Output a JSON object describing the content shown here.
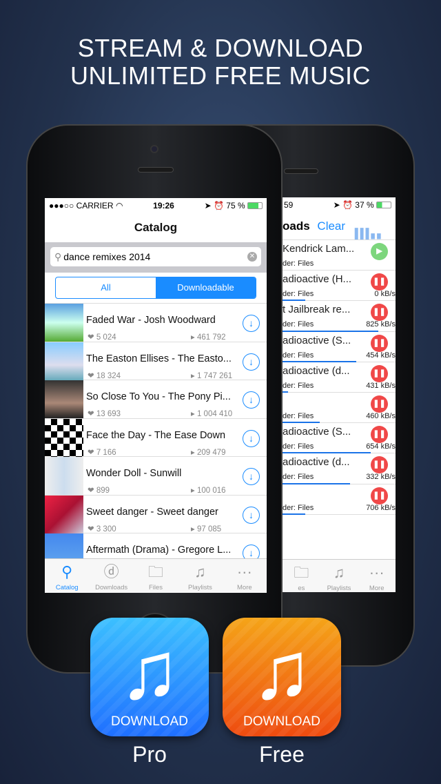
{
  "headline": {
    "line1": "STREAM & DOWNLOAD",
    "line2": "UNLIMITED FREE MUSIC"
  },
  "front": {
    "status": {
      "carrier": "●●●○○ CARRIER",
      "time": "19:26",
      "battery": "75 %"
    },
    "nav_title": "Catalog",
    "search": {
      "value": "dance remixes 2014",
      "icon": "search-icon"
    },
    "segments": [
      "All",
      "Downloadable"
    ],
    "selected_segment": "Downloadable",
    "tracks": [
      {
        "title": "Faded War - Josh Woodward",
        "likes": "5 024",
        "plays": "461 792"
      },
      {
        "title": "The Easton Ellises - The Easto...",
        "likes": "18 324",
        "plays": "1 747 261"
      },
      {
        "title": "So Close To You - The Pony Pi...",
        "likes": "13 693",
        "plays": "1 004 410"
      },
      {
        "title": "Face the Day - The Ease Down",
        "likes": "7 166",
        "plays": "209 479"
      },
      {
        "title": "Wonder Doll - Sunwill",
        "likes": "899",
        "plays": "100 016"
      },
      {
        "title": "Sweet danger - Sweet danger",
        "likes": "3 300",
        "plays": "97 085"
      },
      {
        "title": "Aftermath (Drama) - Gregore L...",
        "likes": "",
        "plays": ""
      }
    ],
    "tabs": [
      "Catalog",
      "Downloads",
      "Files",
      "Playlists",
      "More"
    ],
    "active_tab": "Catalog"
  },
  "back": {
    "status": {
      "time": "59",
      "battery": "37 %"
    },
    "nav_title": "oads",
    "clear": "Clear",
    "downloads": [
      {
        "title": "Kendrick Lam...",
        "folder": "der: Files",
        "speed": "",
        "state": "play",
        "progress": 0
      },
      {
        "title": "adioactive (H...",
        "folder": "der: Files",
        "speed": "0 kB/s",
        "state": "pause",
        "progress": 0.2
      },
      {
        "title": "t Jailbreak re...",
        "folder": "der: Files",
        "speed": "825 kB/s",
        "state": "pause",
        "progress": 0.85
      },
      {
        "title": "adioactive (S...",
        "folder": "der: Files",
        "speed": "454 kB/s",
        "state": "pause",
        "progress": 0.65
      },
      {
        "title": "adioactive (d...",
        "folder": "der: Files",
        "speed": "431 kB/s",
        "state": "pause",
        "progress": 0.05
      },
      {
        "title": "",
        "folder": "der: Files",
        "speed": "460 kB/s",
        "state": "pause",
        "progress": 0.33
      },
      {
        "title": "adioactive (S...",
        "folder": "der: Files",
        "speed": "654 kB/s",
        "state": "pause",
        "progress": 0.78
      },
      {
        "title": "adioactive (d...",
        "folder": "der: Files",
        "speed": "332 kB/s",
        "state": "pause",
        "progress": 0.6
      },
      {
        "title": "",
        "folder": "der: Files",
        "speed": "706 kB/s",
        "state": "pause",
        "progress": 0.2
      }
    ],
    "tabs": [
      "es",
      "Playlists",
      "More"
    ]
  },
  "apps": [
    {
      "label": "DOWNLOAD",
      "name": "Pro"
    },
    {
      "label": "DOWNLOAD",
      "name": "Free"
    }
  ],
  "colors": {
    "accent": "#1a8cff",
    "pause": "#f04848",
    "play": "#7dd67d",
    "pro_icon": "#1f8fff",
    "free_icon": "#f07a10"
  }
}
